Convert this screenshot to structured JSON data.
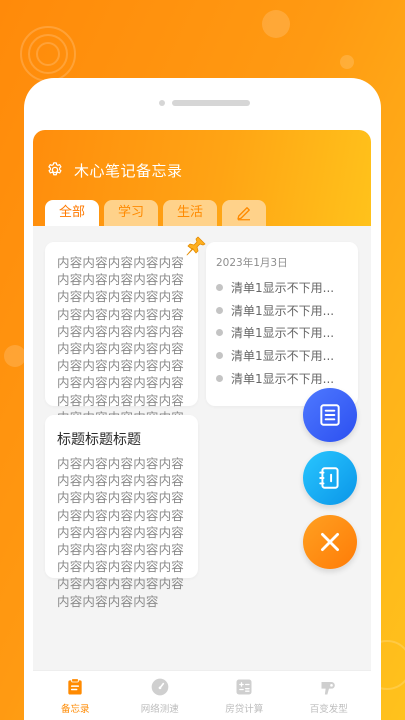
{
  "app": {
    "title": "木心笔记备忘录"
  },
  "tabs": [
    {
      "label": "全部",
      "active": true
    },
    {
      "label": "学习",
      "active": false
    },
    {
      "label": "生活",
      "active": false
    }
  ],
  "edit_tab_icon": "pencil-icon",
  "notes": [
    {
      "title": "",
      "body": "内容内容内容内容内容内容内容内容内容内容内容内容内容内容内容内容内容内容内容内容内容内容内容内容内容内容内容内容内容内容内容内容内容内容内容内容内容内容内容内容内容内容内容内容内容内容内容内容内容内容",
      "pinned": true
    },
    {
      "title": "标题标题标题",
      "body": "内容内容内容内容内容内容内容内容内容内容内容内容内容内容内容内容内容内容内容内容内容内容内容内容内容内容内容内容内容内容内容内容内容内容内容内容内容内容内容内容内容内容内容内容",
      "pinned": false
    }
  ],
  "checklist": {
    "date": "2023年1月3日",
    "items": [
      "清单1显示不下用...",
      "清单1显示不下用...",
      "清单1显示不下用...",
      "清单1显示不下用...",
      "清单1显示不下用..."
    ]
  },
  "fabs": [
    {
      "name": "list-fab",
      "icon": "list-icon",
      "color": "#3a63f8"
    },
    {
      "name": "notebook-fab",
      "icon": "notebook-icon",
      "color": "#16aef3"
    },
    {
      "name": "close-fab",
      "icon": "close-icon",
      "color": "#ff8d12"
    }
  ],
  "bottom_nav": [
    {
      "label": "备忘录",
      "icon": "memo-icon",
      "active": true
    },
    {
      "label": "网络测速",
      "icon": "speed-gauge-icon",
      "active": false
    },
    {
      "label": "房贷计算",
      "icon": "calculator-icon",
      "active": false
    },
    {
      "label": "百变发型",
      "icon": "hair-dryer-icon",
      "active": false
    }
  ],
  "colors": {
    "accent": "#ff8a00",
    "header_gradient_end": "#ffc21b",
    "tab_inactive_bg": "#ffd28a"
  }
}
